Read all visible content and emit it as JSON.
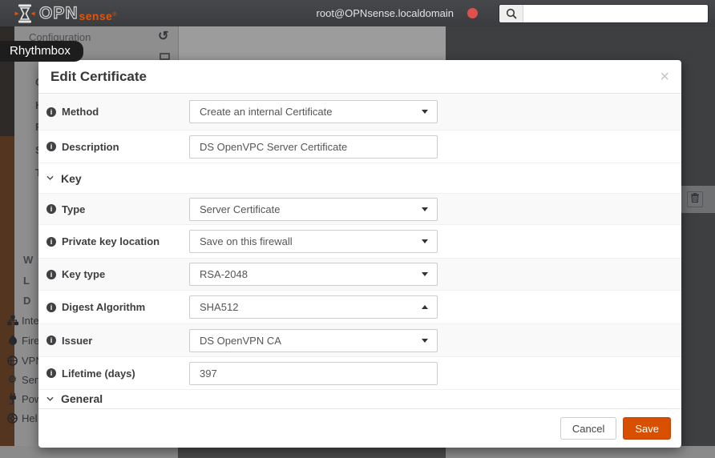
{
  "topbar": {
    "logo_prefix": "OPN",
    "logo_suffix": "sense",
    "logo_reg": "®",
    "user": "root@OPNsense.localdomain",
    "search_value": ""
  },
  "tooltip": {
    "label": "Rhythmbox"
  },
  "background": {
    "sidebar_top_item": "Configuration",
    "history_glyph": "↺",
    "menu_letter_fragments": [
      "G",
      "H",
      "R",
      "S",
      "T",
      "W",
      "L",
      "D"
    ],
    "menu_items": [
      {
        "icon": "sitemap-icon",
        "label": "Inte"
      },
      {
        "icon": "fire-icon",
        "label": "Fire"
      },
      {
        "icon": "globe-icon",
        "label": "VPN"
      },
      {
        "icon": "gear-icon",
        "label": "Serv"
      },
      {
        "icon": "plug-icon",
        "label": "Pow"
      },
      {
        "icon": "life-ring-icon",
        "label": "Hel"
      }
    ]
  },
  "modal": {
    "title": "Edit Certificate",
    "close_glyph": "×",
    "fields": {
      "method": {
        "label": "Method",
        "value": "Create an internal Certificate"
      },
      "description": {
        "label": "Description",
        "value": "DS OpenVPC Server Certificate"
      },
      "key_section": {
        "label": "Key"
      },
      "type": {
        "label": "Type",
        "value": "Server Certificate"
      },
      "private_key_location": {
        "label": "Private key location",
        "value": "Save on this firewall"
      },
      "key_type": {
        "label": "Key type",
        "value": "RSA-2048"
      },
      "digest_algorithm": {
        "label": "Digest Algorithm",
        "value": "SHA512"
      },
      "issuer": {
        "label": "Issuer",
        "value": "DS OpenVPN CA"
      },
      "lifetime": {
        "label": "Lifetime (days)",
        "value": "397"
      },
      "general_section": {
        "label": "General"
      }
    },
    "footer": {
      "cancel_label": "Cancel",
      "save_label": "Save"
    }
  },
  "colors": {
    "accent": "#d94f00",
    "topbar": "#3e4043",
    "status_dot": "#e0504b",
    "stripe": "#f9f9f9"
  }
}
